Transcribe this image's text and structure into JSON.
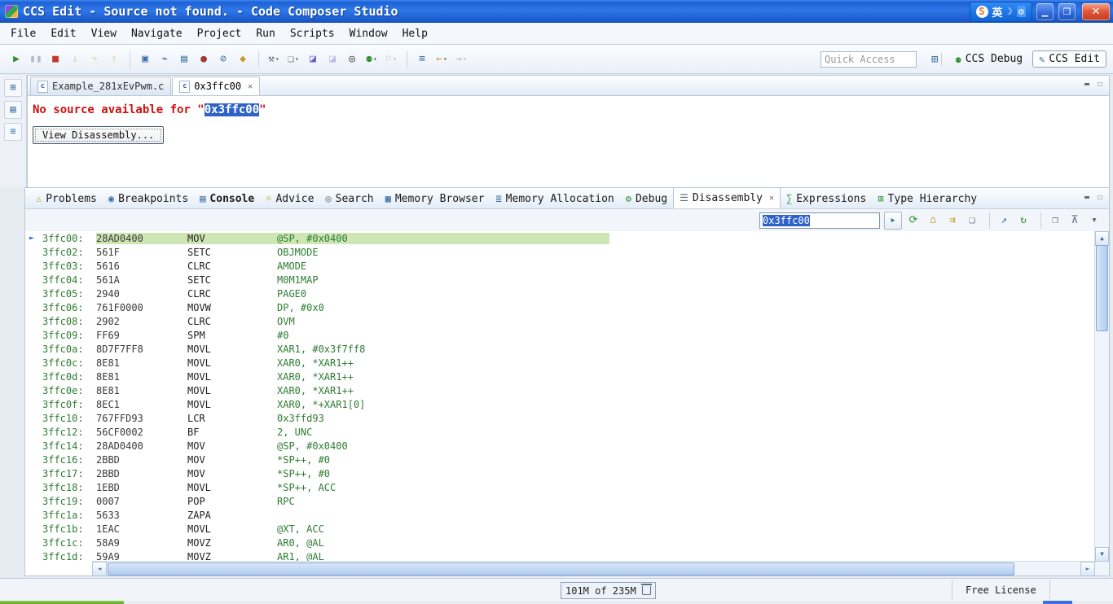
{
  "titlebar": {
    "title": "CCS Edit - Source not found. - Code Composer Studio",
    "ime": {
      "logo": "S",
      "lang": "英",
      "mode_glyph": "☽",
      "tool_glyph": "⚙"
    }
  },
  "menubar": {
    "items": [
      "File",
      "Edit",
      "View",
      "Navigate",
      "Project",
      "Run",
      "Scripts",
      "Window",
      "Help"
    ]
  },
  "toolbar": {
    "quick_access_placeholder": "Quick Access",
    "icons": [
      {
        "name": "resume-icon",
        "glyph": "▶",
        "cls": "c-green"
      },
      {
        "name": "pause-icon",
        "glyph": "▮▮",
        "cls": "c-grey dim"
      },
      {
        "name": "terminate-icon",
        "glyph": "■",
        "cls": "c-red"
      },
      {
        "name": "step-into-icon",
        "glyph": "↓",
        "cls": "c-gold dim"
      },
      {
        "name": "step-over-icon",
        "glyph": "↷",
        "cls": "c-gold dim"
      },
      {
        "name": "step-return-icon",
        "glyph": "↑",
        "cls": "c-gold dim"
      },
      {
        "name": "target-config-icon",
        "glyph": "▣",
        "cls": "c-blue sepL"
      },
      {
        "name": "connect-target-icon",
        "glyph": "⌁",
        "cls": "c-blue"
      },
      {
        "name": "flash-icon",
        "glyph": "▤",
        "cls": "c-blue"
      },
      {
        "name": "toggle-breakpoint-icon",
        "glyph": "●",
        "cls": "c-maroon"
      },
      {
        "name": "skip-breakpoints-icon",
        "glyph": "⊘",
        "cls": "c-blue"
      },
      {
        "name": "fill-memory-icon",
        "glyph": "◆",
        "cls": "c-gold"
      },
      {
        "name": "build-icon",
        "glyph": "⚒",
        "cls": "c-grey dd sepL"
      },
      {
        "name": "new-file-icon",
        "glyph": "❏",
        "cls": "c-grey dd"
      },
      {
        "name": "save-icon",
        "glyph": "◪",
        "cls": "c-purple"
      },
      {
        "name": "save-all-icon",
        "glyph": "◪",
        "cls": "c-purple dim"
      },
      {
        "name": "search-icon",
        "glyph": "◎",
        "cls": "c-dark"
      },
      {
        "name": "debug-icon",
        "glyph": "⚉",
        "cls": "c-green dd"
      },
      {
        "name": "run-flag-icon",
        "glyph": "⚐",
        "cls": "c-grey dd dim"
      },
      {
        "name": "annotation-list-icon",
        "glyph": "≡",
        "cls": "c-blue sepL"
      },
      {
        "name": "back-history-icon",
        "glyph": "←",
        "cls": "c-gold dd"
      },
      {
        "name": "forward-history-icon",
        "glyph": "→",
        "cls": "c-grey dd dim"
      }
    ],
    "perspectives": {
      "items": [
        {
          "label": "CCS Debug",
          "glyph": "⚉",
          "cls": "c-green"
        },
        {
          "label": "CCS Edit",
          "glyph": "✎",
          "cls": "c-blue",
          "active": true
        }
      ]
    }
  },
  "leftstrip": {
    "icons": [
      {
        "name": "restore-views-icon",
        "glyph": "⊞"
      },
      {
        "name": "project-explorer-icon",
        "glyph": "▤"
      },
      {
        "name": "outline-icon",
        "glyph": "≡"
      }
    ]
  },
  "editor": {
    "tabs": [
      {
        "label": "Example_281xEvPwm.c",
        "glyph": "c"
      },
      {
        "label": "0x3ffc00",
        "glyph": "c",
        "active": true,
        "closable": true
      }
    ],
    "message_prefix": "No source available for ",
    "quote_open": "\"",
    "message_value": "0x3ffc00",
    "quote_close": "\"",
    "button_label": "View Disassembly..."
  },
  "panel": {
    "tabs": [
      {
        "label": "Problems",
        "glyph": "⚠",
        "cls": "c-gold"
      },
      {
        "label": "Breakpoints",
        "glyph": "◉",
        "cls": "c-blue"
      },
      {
        "label": "Console",
        "glyph": "▤",
        "cls": "c-blue",
        "bold": true
      },
      {
        "label": "Advice",
        "glyph": "☼",
        "cls": "c-gold"
      },
      {
        "label": "Search",
        "glyph": "◎",
        "cls": "c-grey"
      },
      {
        "label": "Memory Browser",
        "glyph": "▦",
        "cls": "c-blue"
      },
      {
        "label": "Memory Allocation",
        "glyph": "≣",
        "cls": "c-blue"
      },
      {
        "label": "Debug",
        "glyph": "⚙",
        "cls": "c-green"
      },
      {
        "label": "Disassembly",
        "glyph": "☰",
        "cls": "c-grey",
        "active": true,
        "closable": true
      },
      {
        "label": "Expressions",
        "glyph": "∑",
        "cls": "c-green"
      },
      {
        "label": "Type Hierarchy",
        "glyph": "⊞",
        "cls": "c-green"
      }
    ]
  },
  "disassembly": {
    "address_value": "0x3ffc00",
    "toolbar_icons": [
      {
        "name": "goto-address-button",
        "glyph": "▸",
        "cls": "btn c-blue"
      },
      {
        "name": "refresh-page-icon",
        "glyph": "⟳",
        "cls": "c-green"
      },
      {
        "name": "home-icon",
        "glyph": "⌂",
        "cls": "c-gold"
      },
      {
        "name": "show-pc-icon",
        "glyph": "⇉",
        "cls": "c-gold"
      },
      {
        "name": "assembly-mode-icon",
        "glyph": "❏",
        "cls": "c-grey"
      },
      {
        "name": "jump-to-pc-icon",
        "glyph": "↗",
        "cls": "c-blue sepL"
      },
      {
        "name": "refresh-view-icon",
        "glyph": "↻",
        "cls": "c-green"
      },
      {
        "name": "new-view-icon",
        "glyph": "❐",
        "cls": "c-grey sepL"
      },
      {
        "name": "pin-view-icon",
        "glyph": "⊼",
        "cls": "c-grey"
      },
      {
        "name": "view-menu-icon",
        "glyph": "▾",
        "cls": "c-grey"
      }
    ],
    "rows": [
      {
        "addr": "3ffc00:",
        "op": "28AD0400",
        "mn": "MOV",
        "args": "@SP, #0x0400",
        "current": true
      },
      {
        "addr": "3ffc02:",
        "op": "561F",
        "mn": "SETC",
        "args": "OBJMODE"
      },
      {
        "addr": "3ffc03:",
        "op": "5616",
        "mn": "CLRC",
        "args": "AMODE"
      },
      {
        "addr": "3ffc04:",
        "op": "561A",
        "mn": "SETC",
        "args": "M0M1MAP"
      },
      {
        "addr": "3ffc05:",
        "op": "2940",
        "mn": "CLRC",
        "args": "PAGE0"
      },
      {
        "addr": "3ffc06:",
        "op": "761F0000",
        "mn": "MOVW",
        "args": "DP, #0x0"
      },
      {
        "addr": "3ffc08:",
        "op": "2902",
        "mn": "CLRC",
        "args": "OVM"
      },
      {
        "addr": "3ffc09:",
        "op": "FF69",
        "mn": "SPM",
        "args": "#0"
      },
      {
        "addr": "3ffc0a:",
        "op": "8D7F7FF8",
        "mn": "MOVL",
        "args": "XAR1, #0x3f7ff8"
      },
      {
        "addr": "3ffc0c:",
        "op": "8E81",
        "mn": "MOVL",
        "args": "XAR0, *XAR1++"
      },
      {
        "addr": "3ffc0d:",
        "op": "8E81",
        "mn": "MOVL",
        "args": "XAR0, *XAR1++"
      },
      {
        "addr": "3ffc0e:",
        "op": "8E81",
        "mn": "MOVL",
        "args": "XAR0, *XAR1++"
      },
      {
        "addr": "3ffc0f:",
        "op": "8EC1",
        "mn": "MOVL",
        "args": "XAR0, *+XAR1[0]"
      },
      {
        "addr": "3ffc10:",
        "op": "767FFD93",
        "mn": "LCR",
        "args": "0x3ffd93"
      },
      {
        "addr": "3ffc12:",
        "op": "56CF0002",
        "mn": "BF",
        "args": "2, UNC"
      },
      {
        "addr": "3ffc14:",
        "op": "28AD0400",
        "mn": "MOV",
        "args": "@SP, #0x0400"
      },
      {
        "addr": "3ffc16:",
        "op": "2BBD",
        "mn": "MOV",
        "args": "*SP++, #0"
      },
      {
        "addr": "3ffc17:",
        "op": "2BBD",
        "mn": "MOV",
        "args": "*SP++, #0"
      },
      {
        "addr": "3ffc18:",
        "op": "1EBD",
        "mn": "MOVL",
        "args": "*SP++, ACC"
      },
      {
        "addr": "3ffc19:",
        "op": "0007",
        "mn": "POP",
        "args": "RPC"
      },
      {
        "addr": "3ffc1a:",
        "op": "5633",
        "mn": "ZAPA",
        "args": ""
      },
      {
        "addr": "3ffc1b:",
        "op": "1EAC",
        "mn": "MOVL",
        "args": "@XT, ACC"
      },
      {
        "addr": "3ffc1c:",
        "op": "58A9",
        "mn": "MOVZ",
        "args": "AR0, @AL"
      },
      {
        "addr": "3ffc1d:",
        "op": "59A9",
        "mn": "MOVZ",
        "args": "AR1, @AL"
      }
    ]
  },
  "statusbar": {
    "heap": "101M of 235M",
    "license": "Free License"
  }
}
